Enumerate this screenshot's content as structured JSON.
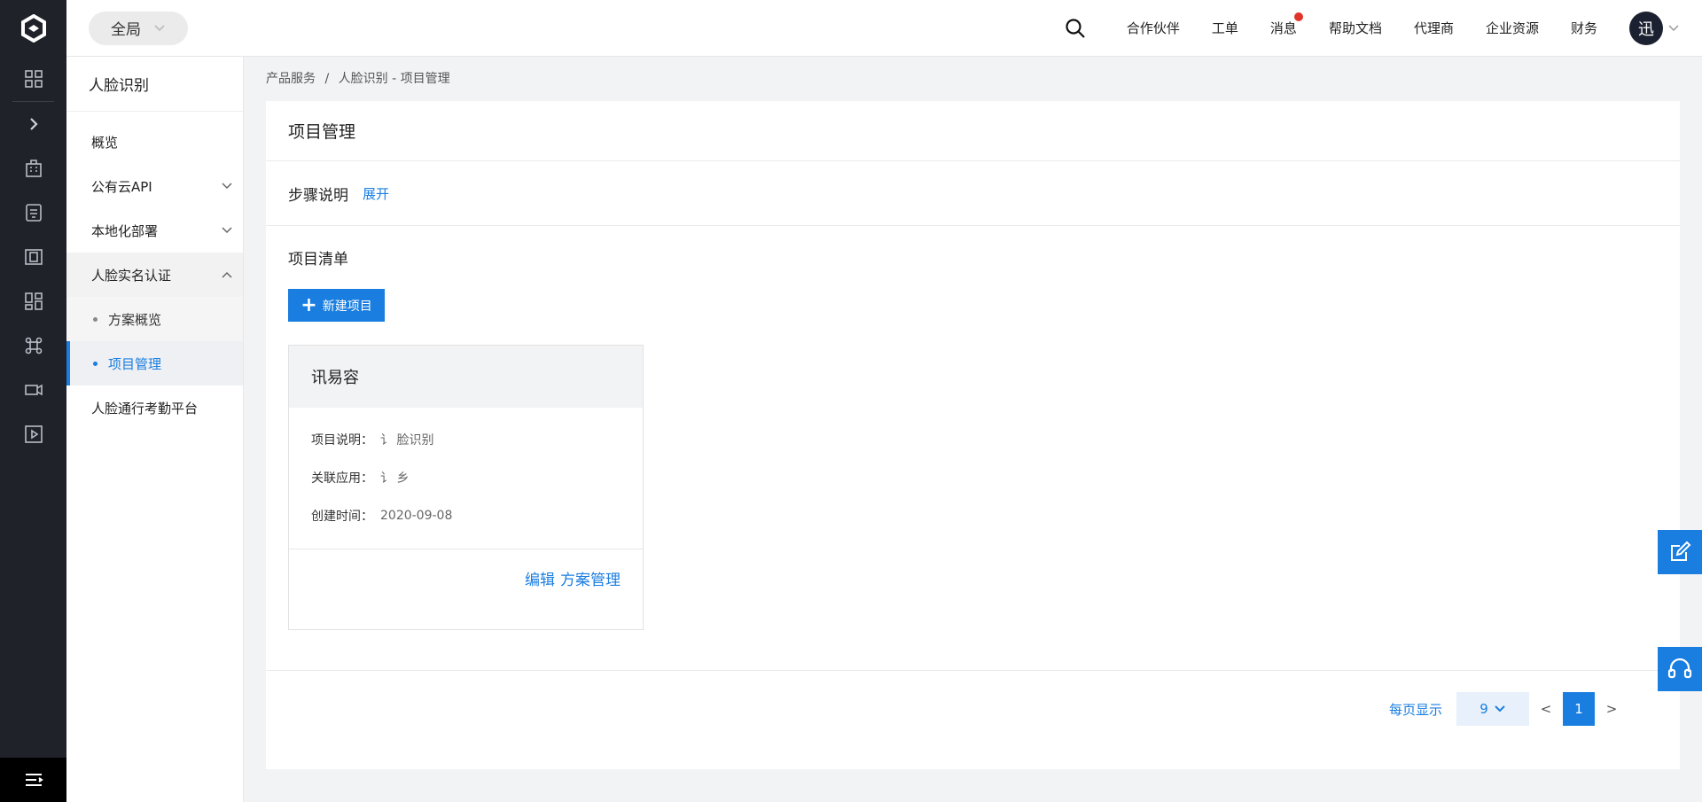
{
  "topbar": {
    "scope_label": "全局",
    "links": [
      "合作伙伴",
      "工单",
      "消息",
      "帮助文档",
      "代理商",
      "企业资源",
      "财务"
    ],
    "avatar_text": "迅"
  },
  "sidebar": {
    "title": "人脸识别",
    "items": [
      {
        "label": "概览"
      },
      {
        "label": "公有云API"
      },
      {
        "label": "本地化部署"
      },
      {
        "label": "人脸实名认证"
      }
    ],
    "subitems": [
      {
        "label": "方案概览"
      },
      {
        "label": "项目管理"
      }
    ],
    "last_item": "人脸通行考勤平台"
  },
  "breadcrumb": {
    "root": "产品服务",
    "separator": "/",
    "current": "人脸识别 - 项目管理"
  },
  "main": {
    "title": "项目管理",
    "steps_label": "步骤说明",
    "expand_label": "展开",
    "list_title": "项目清单",
    "new_button": "新建项目"
  },
  "card": {
    "name": "讯易容",
    "desc_label": "项目说明：",
    "desc_value": "讠 脸识别",
    "app_label": "关联应用：",
    "app_value": "讠 乡",
    "created_label": "创建时间：",
    "created_value": "2020-09-08",
    "edit_label": "编辑",
    "manage_label": "方案管理"
  },
  "pager": {
    "per_page_label": "每页显示",
    "page_size": "9",
    "prev": "<",
    "current_page": "1",
    "next": ">"
  },
  "colors": {
    "accent": "#1a7ee0",
    "rail": "#1f2229",
    "badge": "#e0352b"
  }
}
